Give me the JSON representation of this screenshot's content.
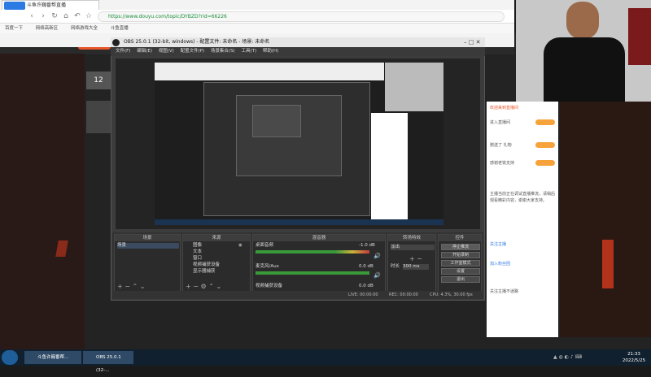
{
  "browser": {
    "tab_title": "斗鱼许巍番帮直播",
    "tab_badge": "百度号",
    "url": "https://www.douyu.com/topic/DYBZD?rid=66226",
    "bookmarks": [
      "百度一下",
      "网络高新区",
      "网络游戏大全",
      "斗鱼直播"
    ]
  },
  "douyu": {
    "logo": "斗鱼",
    "room_num": "12",
    "chat_lines": [
      "欢迎来到直播间",
      "进入直播间",
      "赠送了 礼物",
      "感谢老铁支持",
      "关注主播不迷路"
    ],
    "notice": "主播当前正在调试直播推流，请稍后观看精彩内容，谢谢大家支持。",
    "links": [
      "关注主播",
      "加入粉丝团"
    ]
  },
  "obs": {
    "title": "OBS 25.0.1 (32-bit, windows) - 配置文件: 未命名 - 场景: 未命名",
    "menu": [
      "文件(F)",
      "编辑(E)",
      "视图(V)",
      "配置文件(P)",
      "场景集合(S)",
      "工具(T)",
      "帮助(H)"
    ],
    "docks": {
      "scenes": {
        "title": "场景",
        "items": [
          "场景"
        ]
      },
      "sources": {
        "title": "来源",
        "items": [
          "图像",
          "文本",
          "窗口",
          "视频捕获设备",
          "显示器捕获"
        ]
      },
      "mixer": {
        "title": "混音器",
        "channels": [
          {
            "name": "桌面音频",
            "db": "-1.0 dB"
          },
          {
            "name": "麦克风/Aux",
            "db": "0.0 dB"
          },
          {
            "name": "视频捕获设备",
            "db": "0.0 dB"
          }
        ]
      },
      "transitions": {
        "title": "转场特效",
        "type": "淡出",
        "duration_label": "时长",
        "duration": "300 ms"
      },
      "controls": {
        "title": "控件",
        "buttons": [
          "停止推流",
          "开始录制",
          "工作室模式",
          "设置",
          "退出"
        ]
      }
    },
    "status": {
      "live": "LIVE: 00:00:00",
      "rec": "REC: 00:00:00",
      "cpu": "CPU: 4.3%, 30.00 fps"
    }
  },
  "taskbar": {
    "tasks": [
      "斗鱼许巍番帮...",
      "OBS 25.0.1 (32-..."
    ],
    "time": "21:33",
    "date": "2022/5/25"
  },
  "colors": {
    "accent": "#e8562a",
    "obs_bg": "#3c3c3c",
    "taskbar": "#10202e"
  }
}
